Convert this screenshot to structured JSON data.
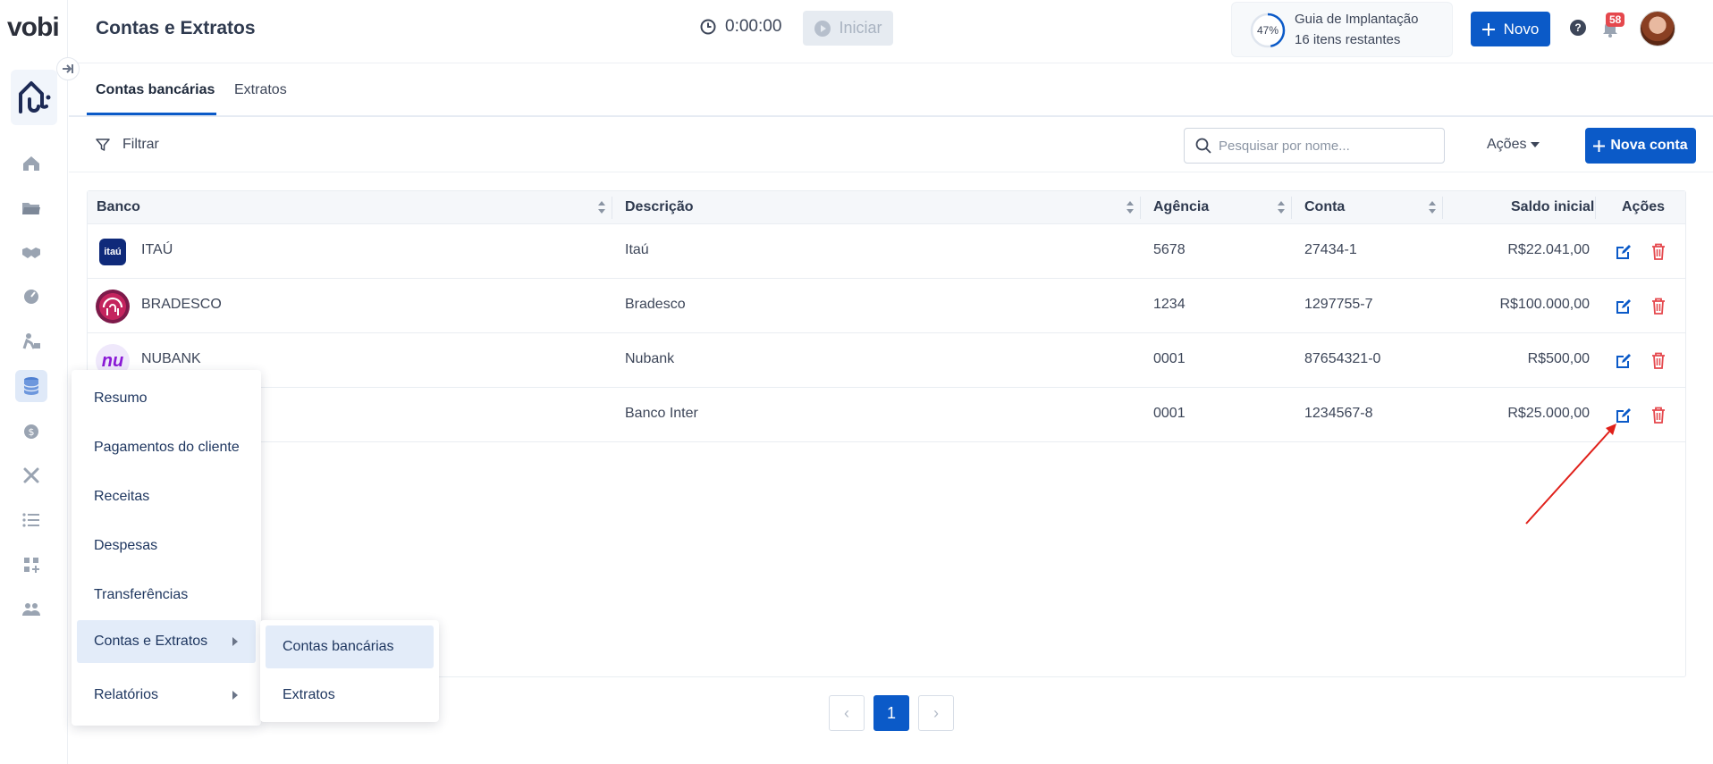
{
  "app": {
    "brand": "vobi",
    "page_title": "Contas e Extratos"
  },
  "timer": {
    "time": "0:00:00",
    "start_label": "Iniciar"
  },
  "guide": {
    "percent": "47%",
    "title": "Guia de Implantação",
    "subtitle": "16 itens restantes"
  },
  "header": {
    "new_label": "Novo",
    "help_label": "?",
    "notifications_count": "58"
  },
  "sidebar": {
    "icons": [
      "home-icon",
      "folder-icon",
      "handshake-icon",
      "dashboard-icon",
      "worker-icon",
      "finance-icon",
      "dollar-icon",
      "tools-icon",
      "list-icon",
      "apps-icon",
      "users-icon"
    ],
    "active": "finance-icon"
  },
  "tabs": [
    {
      "label": "Contas bancárias",
      "active": true
    },
    {
      "label": "Extratos",
      "active": false
    }
  ],
  "toolbar": {
    "filter_label": "Filtrar",
    "search_placeholder": "Pesquisar por nome...",
    "actions_label": "Ações",
    "new_account_label": "Nova conta"
  },
  "table": {
    "headers": {
      "bank": "Banco",
      "description": "Descrição",
      "agency": "Agência",
      "account": "Conta",
      "initial_balance": "Saldo inicial",
      "actions": "Ações"
    },
    "rows": [
      {
        "bank": "ITAÚ",
        "logo_text": "itaú",
        "description": "Itaú",
        "agency": "5678",
        "account": "27434-1",
        "initial_balance": "R$22.041,00"
      },
      {
        "bank": "BRADESCO",
        "logo_text": "",
        "description": "Bradesco",
        "agency": "1234",
        "account": "1297755-7",
        "initial_balance": "R$100.000,00"
      },
      {
        "bank": "NUBANK",
        "logo_text": "nu",
        "description": "Nubank",
        "agency": "0001",
        "account": "87654321-0",
        "initial_balance": "R$500,00"
      },
      {
        "bank": "",
        "logo_text": "",
        "description": "Banco Inter",
        "agency": "0001",
        "account": "1234567-8",
        "initial_balance": "R$25.000,00"
      }
    ]
  },
  "pagination": {
    "prev": "‹",
    "current": "1",
    "next": "›"
  },
  "flyout_menu": {
    "items": [
      {
        "label": "Resumo"
      },
      {
        "label": "Pagamentos do cliente"
      },
      {
        "label": "Receitas"
      },
      {
        "label": "Despesas"
      },
      {
        "label": "Transferências"
      },
      {
        "label": "Contas e Extratos"
      },
      {
        "label": "Relatórios"
      }
    ],
    "submenu": [
      {
        "label": "Contas bancárias"
      },
      {
        "label": "Extratos"
      }
    ]
  },
  "colors": {
    "primary": "#0b5ac8",
    "danger": "#e5484d",
    "annotation_arrow": "#e0201a"
  }
}
